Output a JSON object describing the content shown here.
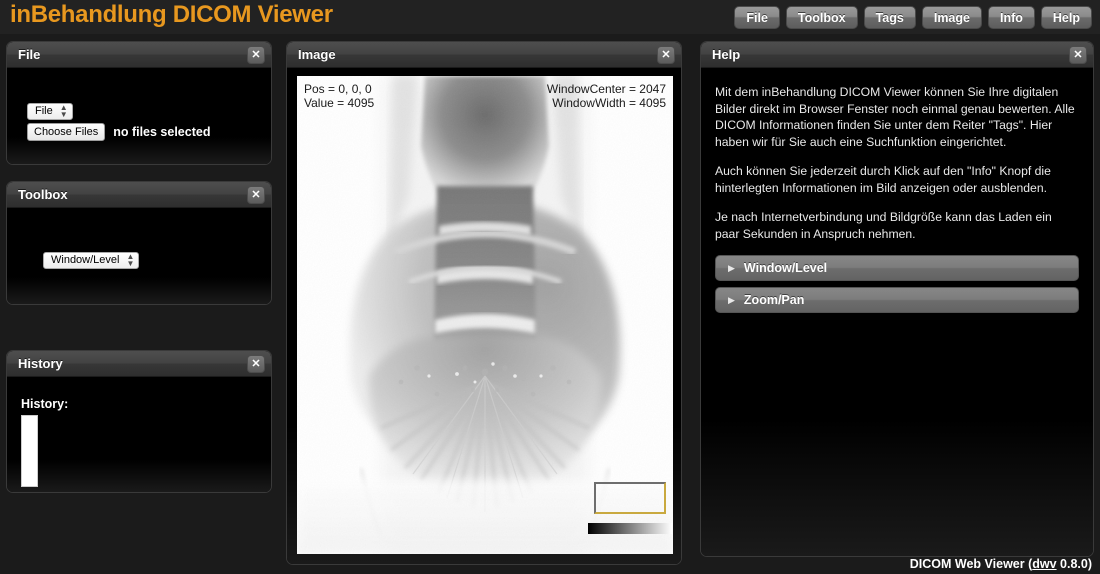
{
  "app": {
    "title": "inBehandlung DICOM Viewer",
    "accent_color": "#e8981f",
    "background_color": "#1b1b1b"
  },
  "nav": {
    "buttons": [
      {
        "label": "File"
      },
      {
        "label": "Toolbox"
      },
      {
        "label": "Tags"
      },
      {
        "label": "Image"
      },
      {
        "label": "Info"
      },
      {
        "label": "Help"
      }
    ]
  },
  "panels": {
    "file": {
      "title": "File",
      "close_icon": "✕",
      "source_select": {
        "value": "File"
      },
      "choose_button": "Choose Files",
      "file_status": "no files selected"
    },
    "toolbox": {
      "title": "Toolbox",
      "close_icon": "✕",
      "tool_select": {
        "value": "Window/Level"
      }
    },
    "history": {
      "title": "History",
      "close_icon": "✕",
      "label": "History:"
    },
    "image": {
      "title": "Image",
      "close_icon": "✕",
      "overlay": {
        "position": "Pos = 0, 0, 0",
        "value": "Value = 4095",
        "window_center": "WindowCenter = 2047",
        "window_width": "WindowWidth = 4095"
      }
    },
    "help": {
      "title": "Help",
      "close_icon": "✕",
      "paragraphs": [
        "Mit dem inBehandlung DICOM Viewer können Sie Ihre digitalen Bilder direkt im Browser Fenster noch einmal genau bewerten. Alle DICOM Informationen finden Sie unter dem Reiter \"Tags\". Hier haben wir für Sie auch eine Suchfunktion eingerichtet.",
        "Auch können Sie jederzeit durch Klick auf den \"Info\" Knopf die hinterlegten Informationen im Bild anzeigen oder ausblenden.",
        "Je nach Internetverbindung und Bildgröße kann das Laden ein paar Sekunden in Anspruch nehmen."
      ],
      "accordion": [
        {
          "label": "Window/Level",
          "arrow": "▶"
        },
        {
          "label": "Zoom/Pan",
          "arrow": "▶"
        }
      ]
    }
  },
  "footer": {
    "prefix": "DICOM Web Viewer (",
    "link": "dwv",
    "suffix": " 0.8.0)"
  }
}
